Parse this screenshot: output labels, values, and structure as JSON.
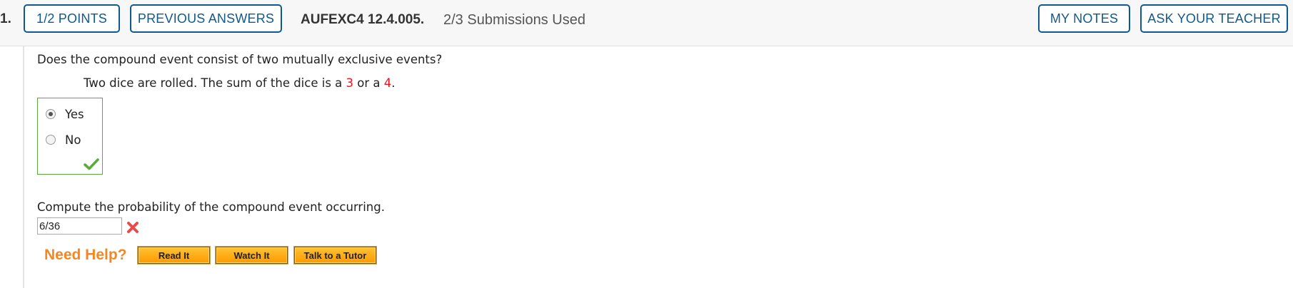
{
  "header": {
    "question_number": "1.",
    "points_label": "1/2 POINTS",
    "previous_answers_label": "PREVIOUS ANSWERS",
    "assignment_code": "AUFEXC4 12.4.005.",
    "submissions_text": "2/3 Submissions Used",
    "my_notes_label": "MY NOTES",
    "ask_teacher_label": "ASK YOUR TEACHER"
  },
  "question": {
    "prompt": "Does the compound event consist of two mutually exclusive events?",
    "scenario_prefix": "Two dice are rolled. The sum of the dice is a ",
    "value_a": "3",
    "scenario_mid": " or a ",
    "value_b": "4",
    "scenario_end": ".",
    "highlight_color": "#e8161b",
    "choices": [
      "Yes",
      "No"
    ],
    "selected_choice": "Yes",
    "choice_status_icon": "checkmark-icon"
  },
  "part2": {
    "prompt": "Compute the probability of the compound event occurring.",
    "answer_value": "6/36",
    "status_icon": "x-mark-icon"
  },
  "help": {
    "label": "Need Help?",
    "read_it": "Read It",
    "watch_it": "Watch It",
    "talk_to_tutor": "Talk to a Tutor"
  },
  "colors": {
    "accent": "#0f5a8c",
    "correct": "#5aaa3e",
    "incorrect": "#e84b4b",
    "help_orange": "#f6861f"
  }
}
